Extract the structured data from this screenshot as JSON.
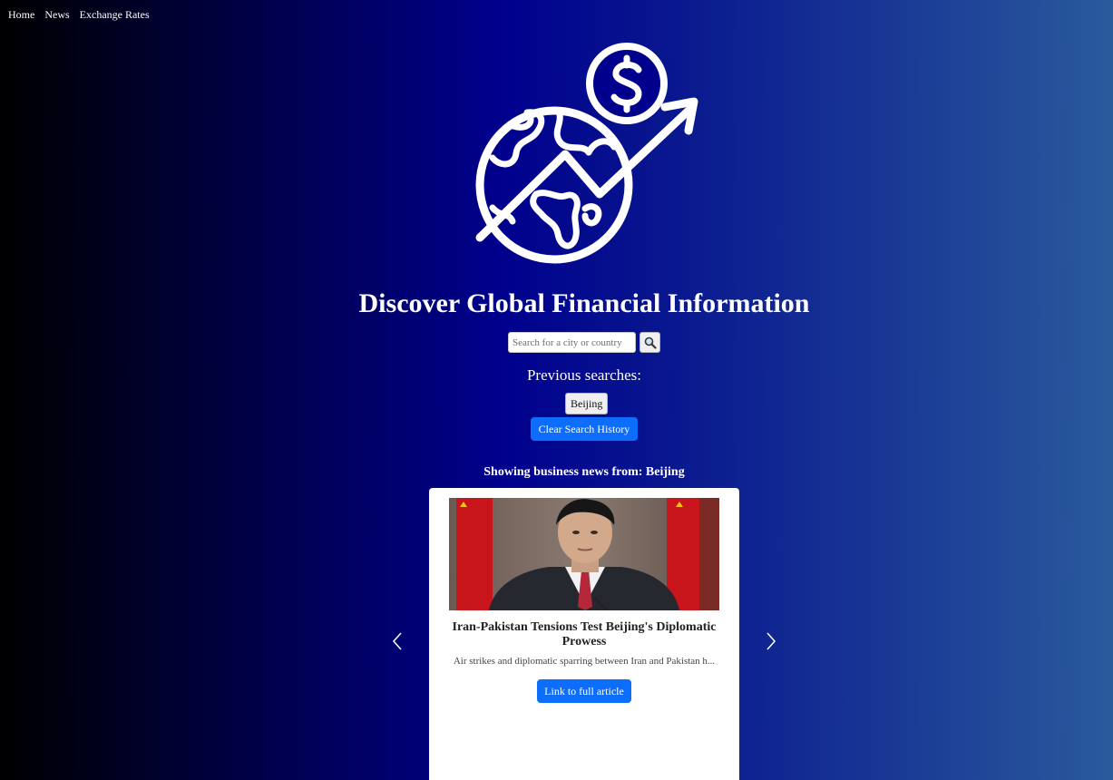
{
  "nav": {
    "items": [
      "Home",
      "News",
      "Exchange Rates"
    ]
  },
  "hero": {
    "logo_icon": "globe-dollar-growth-icon",
    "title": "Discover Global Financial Information"
  },
  "search": {
    "placeholder": "Search for a city or country",
    "button_icon": "search-icon"
  },
  "history": {
    "label": "Previous searches:",
    "items": [
      "Beijing"
    ],
    "clear_label": "Clear Search History"
  },
  "news": {
    "heading": "Showing business news from: Beijing",
    "article": {
      "title": "Iran-Pakistan Tensions Test Beijing's Diplomatic Prowess",
      "description": "Air strikes and diplomatic sparring between Iran and Pakistan h...",
      "link_label": "Link to full article"
    },
    "prev_icon": "chevron-left-icon",
    "next_icon": "chevron-right-icon"
  },
  "colors": {
    "primary_button": "#0d6efd",
    "gradient_start": "#000000",
    "gradient_mid": "#00008d",
    "gradient_end": "#2a5a9c"
  }
}
